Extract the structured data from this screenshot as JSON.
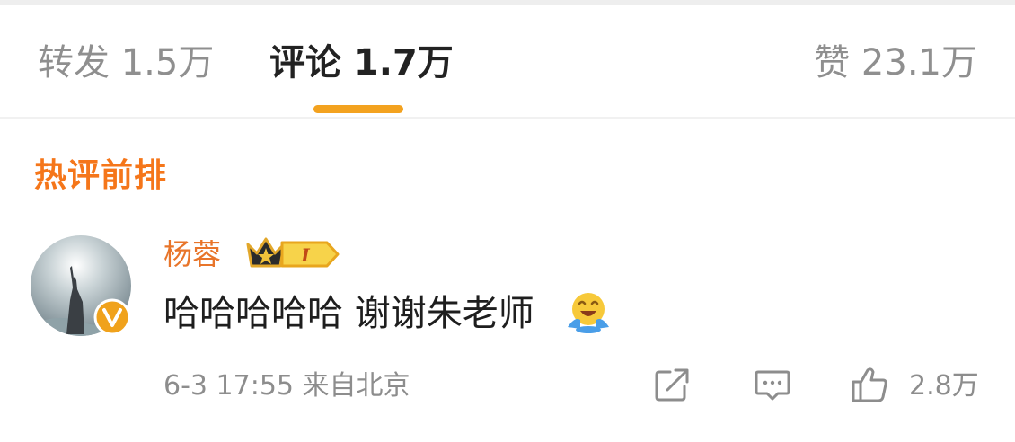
{
  "tabs": {
    "repost": "转发 1.5万",
    "comment": "评论 1.7万",
    "like": "赞 23.1万"
  },
  "section_title": "热评前排",
  "comment": {
    "username": "杨蓉",
    "level_badge": "I",
    "text": "哈哈哈哈哈 谢谢朱老师",
    "emoji": "laughing-face-emoji",
    "meta": "6-3 17:55 来自北京",
    "like_count": "2.8万"
  },
  "colors": {
    "accent": "#f3a21f",
    "section_title": "#f5761a",
    "username": "#e8752a",
    "muted": "#8d8d8d"
  },
  "icons": [
    "share-icon",
    "comment-icon",
    "like-icon",
    "crown-icon",
    "verified-badge-icon"
  ]
}
